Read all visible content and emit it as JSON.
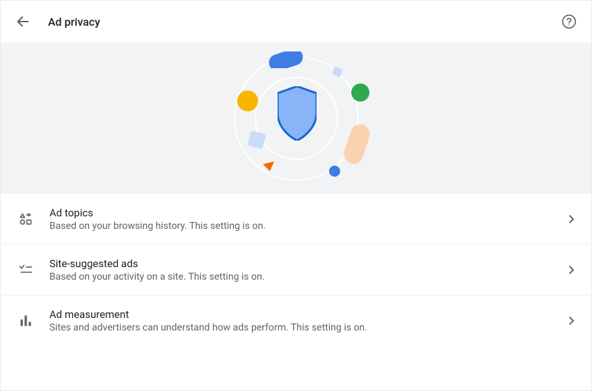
{
  "header": {
    "title": "Ad privacy"
  },
  "settings": [
    {
      "title": "Ad topics",
      "subtitle": "Based on your browsing history. This setting is on."
    },
    {
      "title": "Site-suggested ads",
      "subtitle": "Based on your activity on a site. This setting is on."
    },
    {
      "title": "Ad measurement",
      "subtitle": "Sites and advertisers can understand how ads perform. This setting is on."
    }
  ]
}
